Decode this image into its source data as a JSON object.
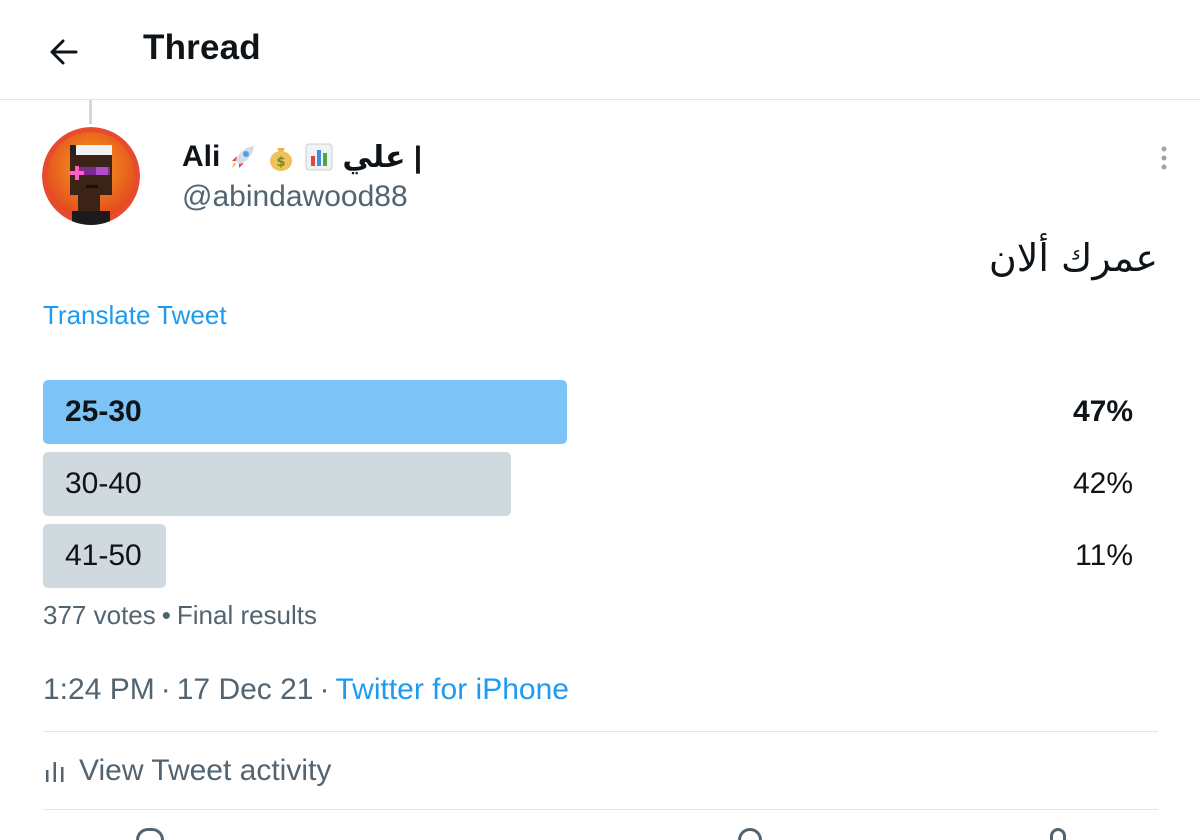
{
  "header": {
    "title": "Thread",
    "back_icon": "arrow-left-icon"
  },
  "author": {
    "name": "Ali",
    "name_suffix": "| علي",
    "emojis": [
      "rocket-icon",
      "money-bag-icon",
      "bar-chart-icon"
    ],
    "handle": "@abindawood88",
    "avatar": "pixel-punk-avatar"
  },
  "tweet": {
    "text": "عمرك ألان",
    "translate_label": "Translate Tweet"
  },
  "poll": {
    "options": [
      {
        "label": "25-30",
        "percent": "47%",
        "value": 47,
        "winner": true
      },
      {
        "label": "30-40",
        "percent": "42%",
        "value": 42,
        "winner": false
      },
      {
        "label": "41-50",
        "percent": "11%",
        "value": 11,
        "winner": false
      }
    ],
    "votes": "377 votes",
    "status": "Final results"
  },
  "meta": {
    "time": "1:24 PM",
    "date": "17 Dec 21",
    "source": "Twitter for iPhone"
  },
  "activity": {
    "label": "View Tweet activity",
    "icon": "analytics-icon"
  },
  "colors": {
    "winner_bar": "#7cc4f5",
    "bar": "#cfd9de",
    "link": "#1d9bf0",
    "muted": "#536471",
    "text": "#0f1419"
  }
}
